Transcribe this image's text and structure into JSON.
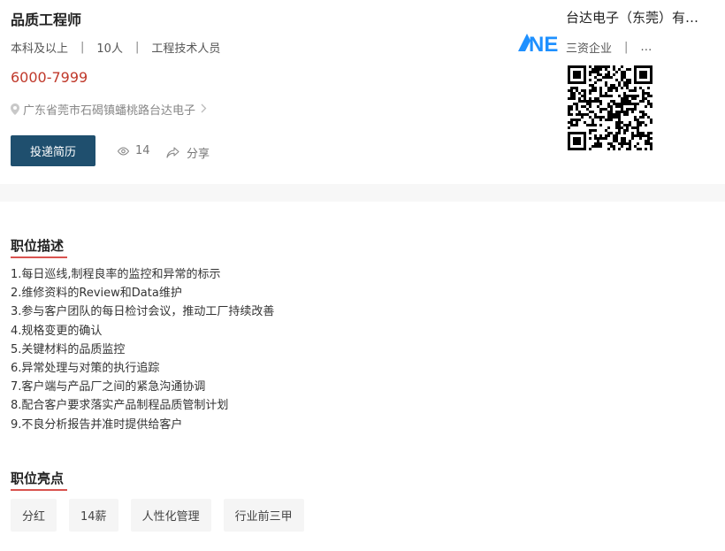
{
  "job": {
    "title": "品质工程师",
    "education": "本科及以上",
    "headcount": "10人",
    "category": "工程技术人员",
    "separator": "|",
    "salary": "6000-7999",
    "address": "广东省莞市石碣镇蟠桃路台达电子",
    "apply_label": "投递简历",
    "views": "14",
    "share_label": "分享"
  },
  "company": {
    "name": "台达电子（东莞）有…",
    "type": "三资企业",
    "separator": "|",
    "more": "…",
    "logo_text": "NE"
  },
  "description": {
    "heading": "职位描述",
    "items": [
      "1.每日巡线,制程良率的监控和异常的标示",
      "2.维修资料的Review和Data维护",
      "3.参与客户团队的每日检讨会议，推动工厂持续改善",
      "4.规格变更的确认",
      "5.关键材料的品质监控",
      "6.异常处理与对策的执行追踪",
      "7.客户端与产品厂之间的紧急沟通协调",
      "8.配合客户要求落实产品制程品质管制计划",
      "9.不良分析报告并准时提供给客户"
    ]
  },
  "highlights": {
    "heading": "职位亮点",
    "tags": [
      "分红",
      "14薪",
      "人性化管理",
      "行业前三甲"
    ]
  },
  "colors": {
    "accent": "#1f4f6e",
    "salary": "#c0392b",
    "underline": "#d9534f",
    "logo": "#1e90ff"
  }
}
